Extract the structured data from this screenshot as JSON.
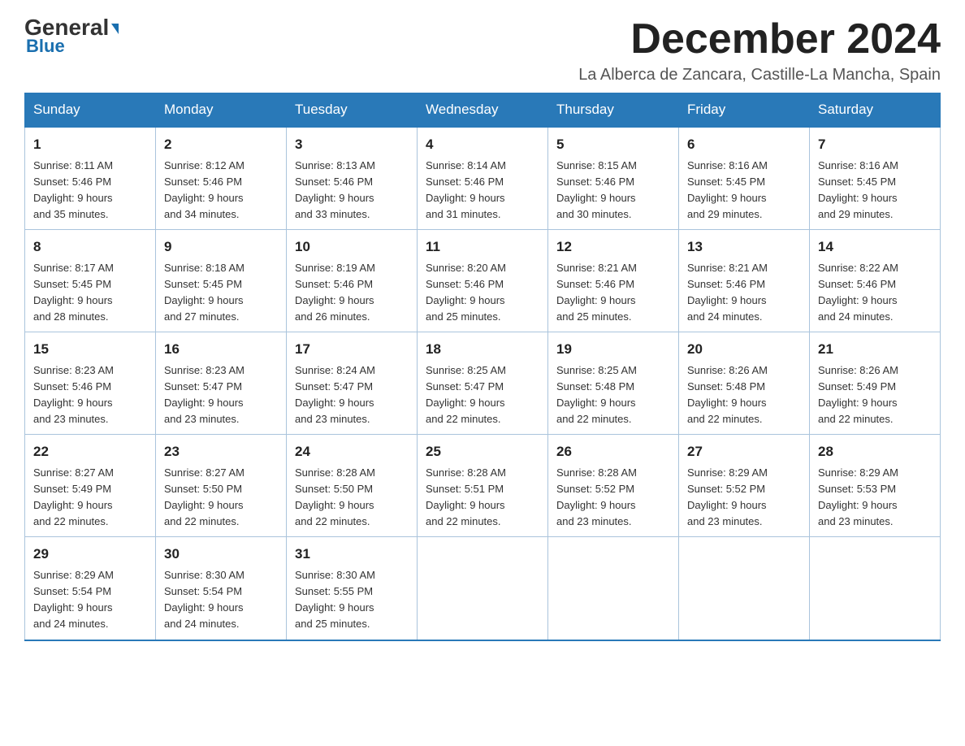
{
  "logo": {
    "general": "General",
    "triangle": "▶",
    "blue": "Blue"
  },
  "header": {
    "month_title": "December 2024",
    "location": "La Alberca de Zancara, Castille-La Mancha, Spain"
  },
  "weekdays": [
    "Sunday",
    "Monday",
    "Tuesday",
    "Wednesday",
    "Thursday",
    "Friday",
    "Saturday"
  ],
  "weeks": [
    [
      {
        "day": "1",
        "sunrise": "8:11 AM",
        "sunset": "5:46 PM",
        "daylight": "9 hours and 35 minutes."
      },
      {
        "day": "2",
        "sunrise": "8:12 AM",
        "sunset": "5:46 PM",
        "daylight": "9 hours and 34 minutes."
      },
      {
        "day": "3",
        "sunrise": "8:13 AM",
        "sunset": "5:46 PM",
        "daylight": "9 hours and 33 minutes."
      },
      {
        "day": "4",
        "sunrise": "8:14 AM",
        "sunset": "5:46 PM",
        "daylight": "9 hours and 31 minutes."
      },
      {
        "day": "5",
        "sunrise": "8:15 AM",
        "sunset": "5:46 PM",
        "daylight": "9 hours and 30 minutes."
      },
      {
        "day": "6",
        "sunrise": "8:16 AM",
        "sunset": "5:45 PM",
        "daylight": "9 hours and 29 minutes."
      },
      {
        "day": "7",
        "sunrise": "8:16 AM",
        "sunset": "5:45 PM",
        "daylight": "9 hours and 29 minutes."
      }
    ],
    [
      {
        "day": "8",
        "sunrise": "8:17 AM",
        "sunset": "5:45 PM",
        "daylight": "9 hours and 28 minutes."
      },
      {
        "day": "9",
        "sunrise": "8:18 AM",
        "sunset": "5:45 PM",
        "daylight": "9 hours and 27 minutes."
      },
      {
        "day": "10",
        "sunrise": "8:19 AM",
        "sunset": "5:46 PM",
        "daylight": "9 hours and 26 minutes."
      },
      {
        "day": "11",
        "sunrise": "8:20 AM",
        "sunset": "5:46 PM",
        "daylight": "9 hours and 25 minutes."
      },
      {
        "day": "12",
        "sunrise": "8:21 AM",
        "sunset": "5:46 PM",
        "daylight": "9 hours and 25 minutes."
      },
      {
        "day": "13",
        "sunrise": "8:21 AM",
        "sunset": "5:46 PM",
        "daylight": "9 hours and 24 minutes."
      },
      {
        "day": "14",
        "sunrise": "8:22 AM",
        "sunset": "5:46 PM",
        "daylight": "9 hours and 24 minutes."
      }
    ],
    [
      {
        "day": "15",
        "sunrise": "8:23 AM",
        "sunset": "5:46 PM",
        "daylight": "9 hours and 23 minutes."
      },
      {
        "day": "16",
        "sunrise": "8:23 AM",
        "sunset": "5:47 PM",
        "daylight": "9 hours and 23 minutes."
      },
      {
        "day": "17",
        "sunrise": "8:24 AM",
        "sunset": "5:47 PM",
        "daylight": "9 hours and 23 minutes."
      },
      {
        "day": "18",
        "sunrise": "8:25 AM",
        "sunset": "5:47 PM",
        "daylight": "9 hours and 22 minutes."
      },
      {
        "day": "19",
        "sunrise": "8:25 AM",
        "sunset": "5:48 PM",
        "daylight": "9 hours and 22 minutes."
      },
      {
        "day": "20",
        "sunrise": "8:26 AM",
        "sunset": "5:48 PM",
        "daylight": "9 hours and 22 minutes."
      },
      {
        "day": "21",
        "sunrise": "8:26 AM",
        "sunset": "5:49 PM",
        "daylight": "9 hours and 22 minutes."
      }
    ],
    [
      {
        "day": "22",
        "sunrise": "8:27 AM",
        "sunset": "5:49 PM",
        "daylight": "9 hours and 22 minutes."
      },
      {
        "day": "23",
        "sunrise": "8:27 AM",
        "sunset": "5:50 PM",
        "daylight": "9 hours and 22 minutes."
      },
      {
        "day": "24",
        "sunrise": "8:28 AM",
        "sunset": "5:50 PM",
        "daylight": "9 hours and 22 minutes."
      },
      {
        "day": "25",
        "sunrise": "8:28 AM",
        "sunset": "5:51 PM",
        "daylight": "9 hours and 22 minutes."
      },
      {
        "day": "26",
        "sunrise": "8:28 AM",
        "sunset": "5:52 PM",
        "daylight": "9 hours and 23 minutes."
      },
      {
        "day": "27",
        "sunrise": "8:29 AM",
        "sunset": "5:52 PM",
        "daylight": "9 hours and 23 minutes."
      },
      {
        "day": "28",
        "sunrise": "8:29 AM",
        "sunset": "5:53 PM",
        "daylight": "9 hours and 23 minutes."
      }
    ],
    [
      {
        "day": "29",
        "sunrise": "8:29 AM",
        "sunset": "5:54 PM",
        "daylight": "9 hours and 24 minutes."
      },
      {
        "day": "30",
        "sunrise": "8:30 AM",
        "sunset": "5:54 PM",
        "daylight": "9 hours and 24 minutes."
      },
      {
        "day": "31",
        "sunrise": "8:30 AM",
        "sunset": "5:55 PM",
        "daylight": "9 hours and 25 minutes."
      },
      null,
      null,
      null,
      null
    ]
  ],
  "labels": {
    "sunrise": "Sunrise:",
    "sunset": "Sunset:",
    "daylight": "Daylight:"
  }
}
